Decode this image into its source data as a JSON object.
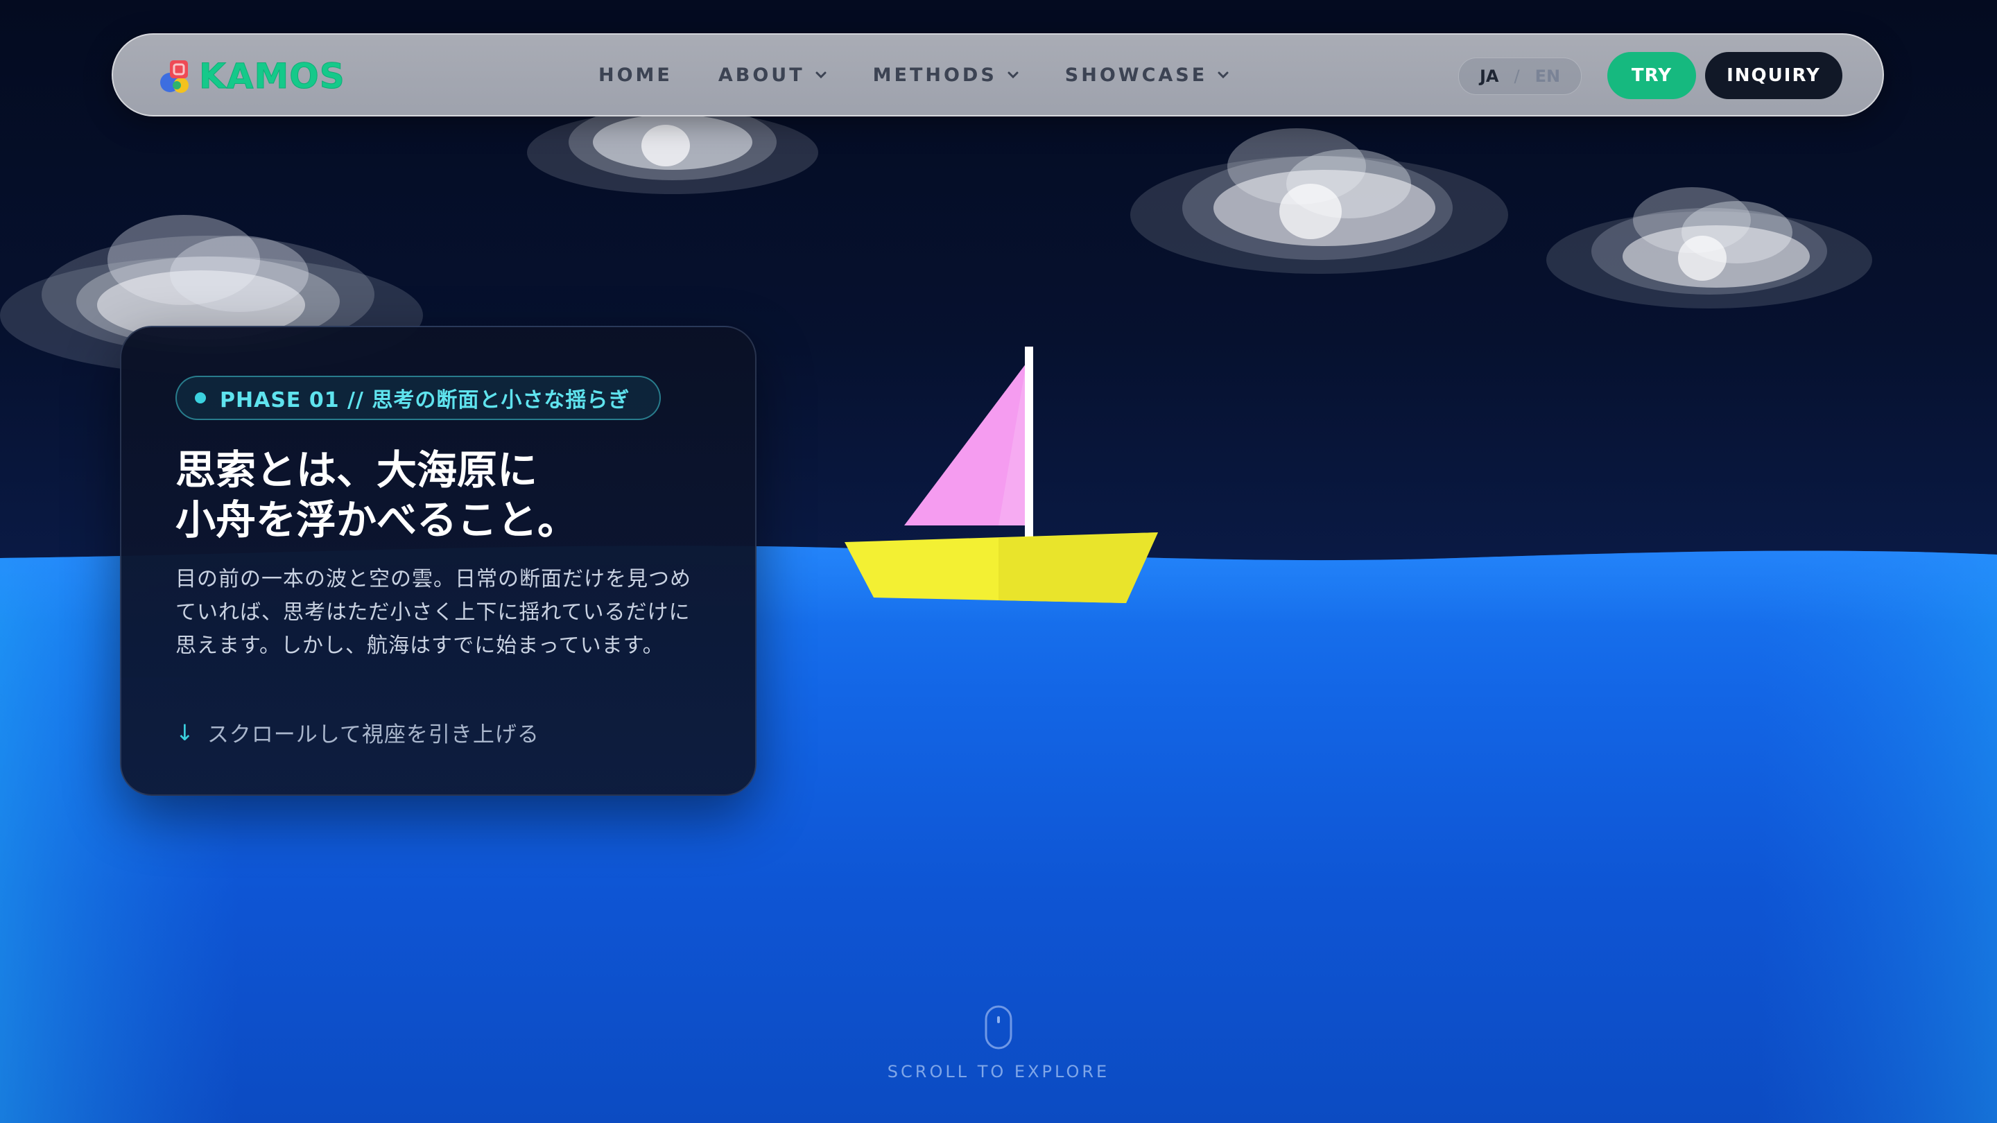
{
  "nav": {
    "logo_text": "KAMOS",
    "links": [
      {
        "label": "HOME",
        "has_dropdown": false
      },
      {
        "label": "ABOUT",
        "has_dropdown": true
      },
      {
        "label": "METHODS",
        "has_dropdown": true
      },
      {
        "label": "SHOWCASE",
        "has_dropdown": true
      }
    ],
    "lang": {
      "ja": "JA",
      "separator": "/",
      "en": "EN",
      "active": "JA"
    },
    "try_label": "TRY",
    "inquiry_label": "INQUIRY"
  },
  "card": {
    "phase_label": "PHASE 01 // 思考の断面と小さな揺らぎ",
    "title_line1": "思索とは、大海原に",
    "title_line2": "小舟を浮かべること。",
    "body": "目の前の一本の波と空の雲。日常の断面だけを見つめていれば、思考はただ小さく上下に揺れているだけに思えます。しかし、航海はすでに始まっています。",
    "scroll_hint_arrow": "↓",
    "scroll_hint_text": "スクロールして視座を引き上げる"
  },
  "scroll_indicator": {
    "label": "SCROLL TO EXPLORE"
  },
  "colors": {
    "accent_green": "#16b97f",
    "dark_button": "#111827",
    "accent_cyan": "#3bd1df",
    "sea_blue": "#0f4fd0",
    "sail_pink": "#f59cf0",
    "hull_yellow": "#f3f033",
    "sky_navy": "#050d24"
  },
  "icons": {
    "logo": "kamos-logo-icon",
    "dropdown": "chevron-down-icon",
    "scroll": "mouse-icon",
    "hint_arrow": "arrow-down-icon"
  }
}
